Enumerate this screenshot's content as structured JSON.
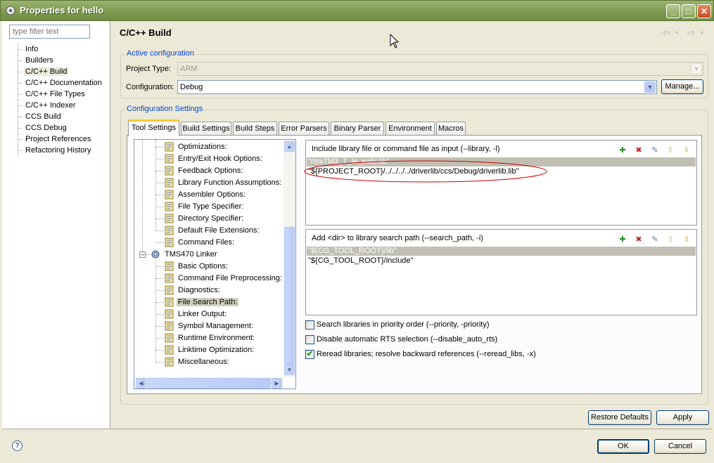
{
  "window": {
    "title": "Properties for hello"
  },
  "filter": {
    "placeholder": "type filter text"
  },
  "nav": [
    {
      "label": "Info"
    },
    {
      "label": "Builders"
    },
    {
      "label": "C/C++ Build"
    },
    {
      "label": "C/C++ Documentation"
    },
    {
      "label": "C/C++ File Types"
    },
    {
      "label": "C/C++ Indexer"
    },
    {
      "label": "CCS Build"
    },
    {
      "label": "CCS Debug"
    },
    {
      "label": "Project References"
    },
    {
      "label": "Refactoring History"
    }
  ],
  "page": {
    "title": "C/C++ Build",
    "back_icon": "⇦",
    "fwd_icon": "⇨"
  },
  "active_config": {
    "group_title": "Active configuration",
    "project_type_label": "Project Type:",
    "project_type_value": "ARM",
    "configuration_label": "Configuration:",
    "configuration_value": "Debug",
    "manage_label": "Manage..."
  },
  "config_settings": {
    "group_title": "Configuration Settings"
  },
  "tabs": [
    {
      "label": "Tool Settings"
    },
    {
      "label": "Build Settings"
    },
    {
      "label": "Build Steps"
    },
    {
      "label": "Error Parsers"
    },
    {
      "label": "Binary Parser"
    },
    {
      "label": "Environment"
    },
    {
      "label": "Macros"
    }
  ],
  "tree": {
    "compiler_children": [
      {
        "label": "Optimizations:"
      },
      {
        "label": "Entry/Exit Hook Options:"
      },
      {
        "label": "Feedback Options:"
      },
      {
        "label": "Library Function Assumptions:"
      },
      {
        "label": "Assembler Options:"
      },
      {
        "label": "File Type Specifier:"
      },
      {
        "label": "Directory Specifier:"
      },
      {
        "label": "Default File Extensions:"
      },
      {
        "label": "Command Files:"
      }
    ],
    "linker": {
      "label": "TMS470 Linker"
    },
    "linker_children": [
      {
        "label": "Basic Options:"
      },
      {
        "label": "Command File Preprocessing:"
      },
      {
        "label": "Diagnostics:"
      },
      {
        "label": "File Search Path:"
      },
      {
        "label": "Linker Output:"
      },
      {
        "label": "Symbol Management:"
      },
      {
        "label": "Runtime Environment:"
      },
      {
        "label": "Linktime Optimization:"
      },
      {
        "label": "Miscellaneous:"
      }
    ]
  },
  "include_list": {
    "header": "Include library file or command file as input (--library, -l)",
    "items": [
      "\"rtsv7M3_T_le_eabi.lib\"",
      "\"${PROJECT_ROOT}/../../../../driverlib/ccs/Debug/driverlib.lib\""
    ]
  },
  "search_path_list": {
    "header": "Add <dir> to library search path (--search_path, -i)",
    "items": [
      "\"${CG_TOOL_ROOT}/lib\"",
      "\"${CG_TOOL_ROOT}/include\""
    ]
  },
  "checkboxes": [
    {
      "label": "Search libraries in priority order (--priority, -priority)",
      "checked": false
    },
    {
      "label": "Disable automatic RTS selection (--disable_auto_rts)",
      "checked": false
    },
    {
      "label": "Reread libraries; resolve backward references (--reread_libs, -x)",
      "checked": true
    }
  ],
  "buttons": {
    "restore_defaults": "Restore Defaults",
    "apply": "Apply",
    "ok": "OK",
    "cancel": "Cancel"
  },
  "help_icon": "?",
  "colors": {
    "titlebar": "#7d9a50",
    "group_title": "#0046d5",
    "annotation_ellipse": "#cc0000",
    "tab_highlight": "#ffc73c"
  }
}
